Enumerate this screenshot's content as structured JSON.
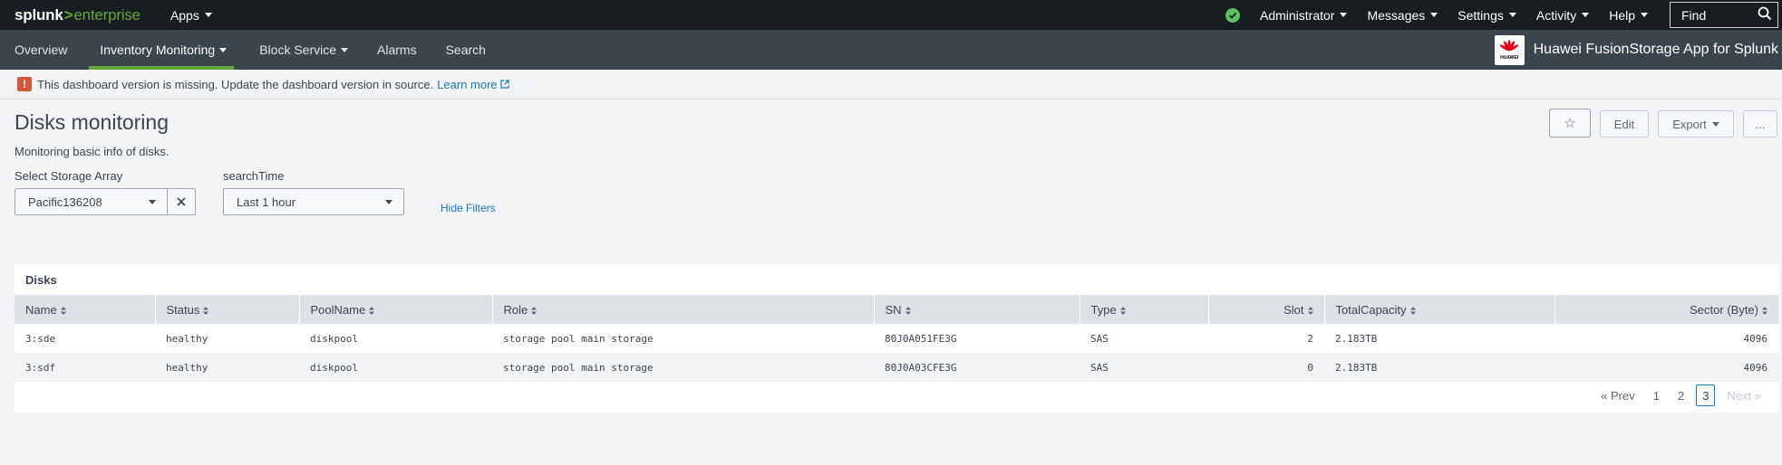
{
  "topbar": {
    "logo_splunk": "splunk",
    "logo_gt": ">",
    "logo_enterprise": "enterprise",
    "apps_label": "Apps",
    "menus": [
      "Administrator",
      "Messages",
      "Settings",
      "Activity",
      "Help"
    ],
    "find_placeholder": "Find"
  },
  "appbar": {
    "nav": [
      {
        "label": "Overview"
      },
      {
        "label": "Inventory Monitoring",
        "active": true,
        "dropdown": true
      },
      {
        "label": "Block Service",
        "dropdown": true
      },
      {
        "label": "Alarms"
      },
      {
        "label": "Search"
      }
    ],
    "app_title": "Huawei FusionStorage App for Splunk",
    "logo_text": "HUAWEI"
  },
  "warning": {
    "icon": "!",
    "message": "This dashboard version is missing. Update the dashboard version in source.",
    "link": "Learn more"
  },
  "dashboard": {
    "title": "Disks monitoring",
    "description": "Monitoring basic info of disks.",
    "actions": {
      "star": "☆",
      "edit": "Edit",
      "export": "Export",
      "more": "..."
    },
    "filters": {
      "storage_label": "Select Storage Array",
      "storage_value": "Pacific136208",
      "time_label": "searchTime",
      "time_value": "Last 1 hour",
      "hide_filters": "Hide Filters"
    }
  },
  "panel": {
    "title": "Disks",
    "columns": [
      "Name",
      "Status",
      "PoolName",
      "Role",
      "SN",
      "Type",
      "Slot",
      "TotalCapacity",
      "Sector (Byte)"
    ],
    "rows": [
      [
        "3:sde",
        "healthy",
        "diskpool",
        "storage pool main storage",
        "80J0A051FE3G",
        "SAS",
        "2",
        "2.183TB",
        "4096"
      ],
      [
        "3:sdf",
        "healthy",
        "diskpool",
        "storage pool main storage",
        "80J0A03CFE3G",
        "SAS",
        "0",
        "2.183TB",
        "4096"
      ]
    ],
    "pager": {
      "prev": "« Prev",
      "pages": [
        "1",
        "2",
        "3"
      ],
      "current": "3",
      "next": "Next »"
    }
  },
  "colors": {
    "accent_green": "#65a637",
    "link_blue": "#1a76bd",
    "warn_red": "#d6563c",
    "topbar": "#171d21",
    "appbar": "#3c444d"
  }
}
